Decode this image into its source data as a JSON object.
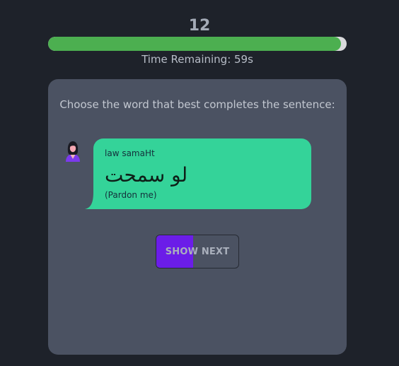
{
  "score": "12",
  "timer": {
    "remaining_fraction": 0.982,
    "label": "Time Remaining: 59s"
  },
  "question": {
    "prompt": "Choose the word that best completes the sentence:"
  },
  "message": {
    "transliteration": "law samaHt",
    "arabic": "لو سمحت",
    "translation": "(Pardon me)"
  },
  "actions": {
    "show_next_label": "SHOW NEXT",
    "show_next_progress": 0.45
  },
  "colors": {
    "background": "#1e222a",
    "card": "#4b5262",
    "progress_fill": "#4caf50",
    "bubble": "#34d399",
    "button_fill": "#6b1de8"
  },
  "icons": {
    "avatar": "woman-avatar-icon"
  }
}
